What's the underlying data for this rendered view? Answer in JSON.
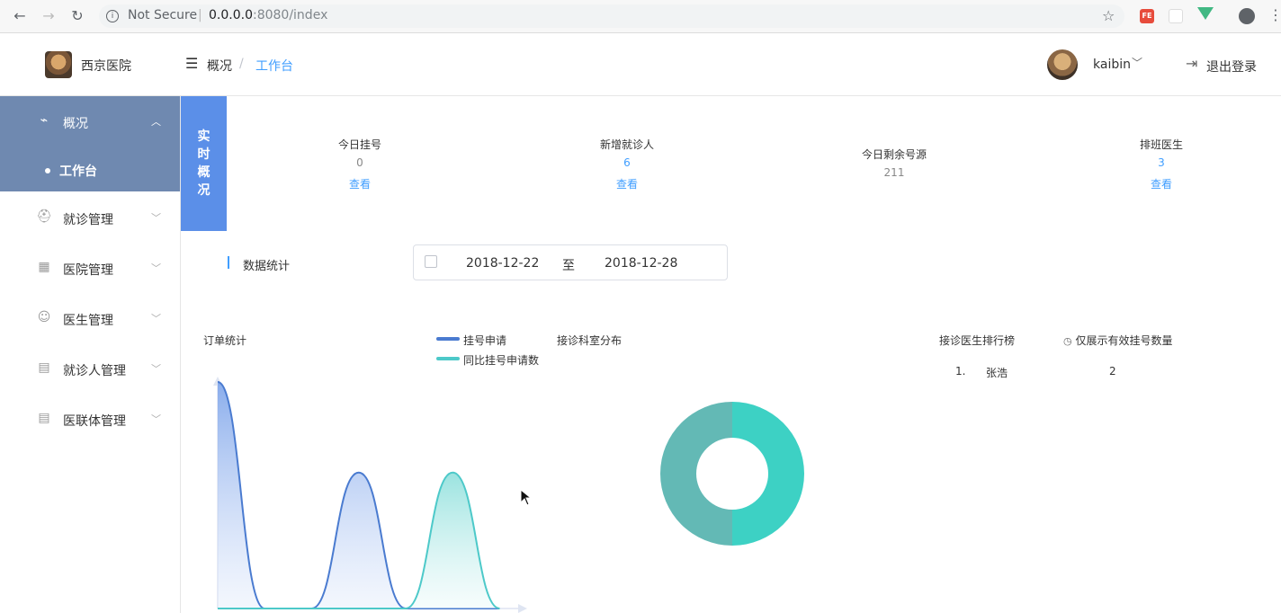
{
  "browser": {
    "security_label": "Not Secure",
    "url_host": "0.0.0.0",
    "url_rest": ":8080/index",
    "ext_fe": "FE"
  },
  "header": {
    "hospital_name": "西京医院",
    "breadcrumb": [
      "概况",
      "工作台"
    ],
    "username": "kaibin",
    "logout": "退出登录"
  },
  "sidebar": {
    "items": [
      {
        "label": "概况",
        "icon": "line-chart-icon",
        "active": true
      },
      {
        "label": "工作台",
        "sub": true
      },
      {
        "label": "就诊管理",
        "icon": "medical-kit-icon"
      },
      {
        "label": "医院管理",
        "icon": "building-icon"
      },
      {
        "label": "医生管理",
        "icon": "doctor-icon"
      },
      {
        "label": "就诊人管理",
        "icon": "id-card-icon"
      },
      {
        "label": "医联体管理",
        "icon": "id-card-icon"
      }
    ]
  },
  "realtime": {
    "tag": [
      "实",
      "时",
      "概",
      "况"
    ],
    "stats": [
      {
        "label": "今日挂号",
        "value": "0",
        "link": "查看"
      },
      {
        "label": "新增就诊人",
        "value": "6",
        "link": "查看"
      },
      {
        "label": "今日剩余号源",
        "value": "211"
      },
      {
        "label": "排班医生",
        "value": "3",
        "link": "查看"
      }
    ]
  },
  "data_stats": {
    "label": "数据统计",
    "start_date": "2018-12-22",
    "separator": "至",
    "end_date": "2018-12-28"
  },
  "colors": {
    "accent": "#409eff",
    "sidebar_active": "#6f89b0",
    "series1": "#4a7bd0",
    "series2": "#4dc9c9",
    "donut_a": "#3dd1c4",
    "donut_b": "#63b9b5"
  },
  "chart_data": [
    {
      "type": "area",
      "title": "订单统计",
      "series": [
        {
          "name": "挂号申请",
          "values": [
            10,
            0,
            0,
            6,
            0,
            0,
            0
          ]
        },
        {
          "name": "同比挂号申请数",
          "values": [
            0,
            0,
            0,
            0,
            0,
            6,
            0
          ]
        }
      ]
    },
    {
      "type": "pie",
      "title": "接诊科室分布",
      "values": [
        50,
        50
      ]
    },
    {
      "type": "table",
      "title": "接诊医生排行榜",
      "note": "仅展示有效挂号数量",
      "rows": [
        {
          "rank": "1.",
          "name": "张浩",
          "value": "2"
        }
      ]
    }
  ]
}
